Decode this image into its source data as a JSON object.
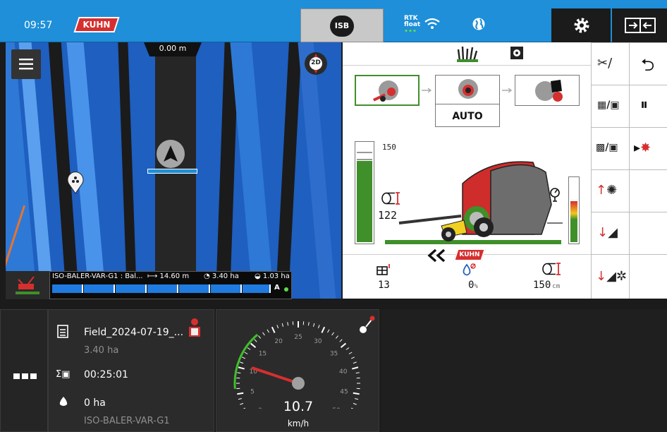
{
  "topbar": {
    "time": "09:57",
    "brand": "KUHN",
    "isb_label": "ISB",
    "rtk_line1": "RTK",
    "rtk_line2": "float"
  },
  "map": {
    "offset": "0.00 m",
    "view_mode": "2D",
    "status": {
      "implement": "ISO-BALER-VAR-G1 : Bal...",
      "width": "14.60 m",
      "area1": "3.40 ha",
      "area2": "1.03 ha",
      "section_mode": "A"
    }
  },
  "baler": {
    "mode_label": "AUTO",
    "chamber_max": "150",
    "bale_diameter_value": "122",
    "bale_count": "13",
    "moisture": "0",
    "moisture_unit": "%",
    "bale_size_value": "150",
    "bale_size_unit": "cm",
    "brand": "KUHN",
    "fill_level": 0.8,
    "pressure_level": 0.62
  },
  "bottom": {
    "field_name": "Field_2024-07-19_...",
    "field_area": "3.40 ha",
    "timer": "00:25:01",
    "worked_area": "0 ha",
    "implement_name": "ISO-BALER-VAR-G1",
    "speed_value": "10.7",
    "speed_unit": "km/h",
    "speed_fraction": 0.214,
    "gauge_ticks": [
      "0",
      "5",
      "10",
      "15",
      "20",
      "25",
      "30",
      "35",
      "40",
      "45",
      "50"
    ]
  },
  "colors": {
    "top_blue": "#1e8fd8",
    "field_blue": "#1e5fc0",
    "brand_red": "#d62f2f",
    "bar_green": "#3f8f2a",
    "panel_white": "#ffffff"
  }
}
